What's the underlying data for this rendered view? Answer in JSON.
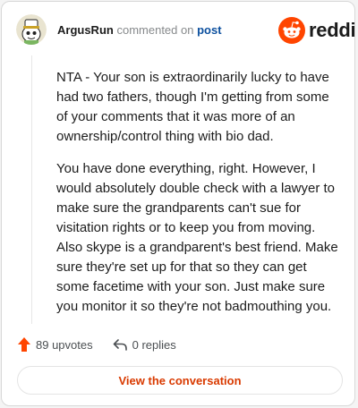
{
  "comment": {
    "username": "ArgusRun",
    "action_text": "commented on",
    "post_link": "post",
    "paragraphs": [
      "NTA - Your son is extraordinarily lucky to have had two fathers, though I'm getting from some of your comments that it was more of an ownership/control thing with bio dad.",
      "You have done everything, right. However, I would absolutely double check with a lawyer to make sure the grandparents can't sue for visitation rights or to keep you from moving. Also skype is a grandparent's best friend. Make sure they're set up for that so they can get some facetime with your son. Just make sure you monitor it so they're not badmouthing you."
    ]
  },
  "brand": {
    "name": "reddit",
    "color": "#ff4500"
  },
  "footer": {
    "upvotes": "89 upvotes",
    "replies": "0 replies",
    "view_button": "View the conversation"
  },
  "icons": {
    "avatar": "snoo-avatar",
    "logo": "reddit-alien-icon",
    "upvote": "upvote-arrow-icon",
    "reply": "reply-arrow-icon"
  },
  "colors": {
    "upvote": "#ff4500",
    "link": "#0b4f9e",
    "button_text": "#d93a00"
  }
}
